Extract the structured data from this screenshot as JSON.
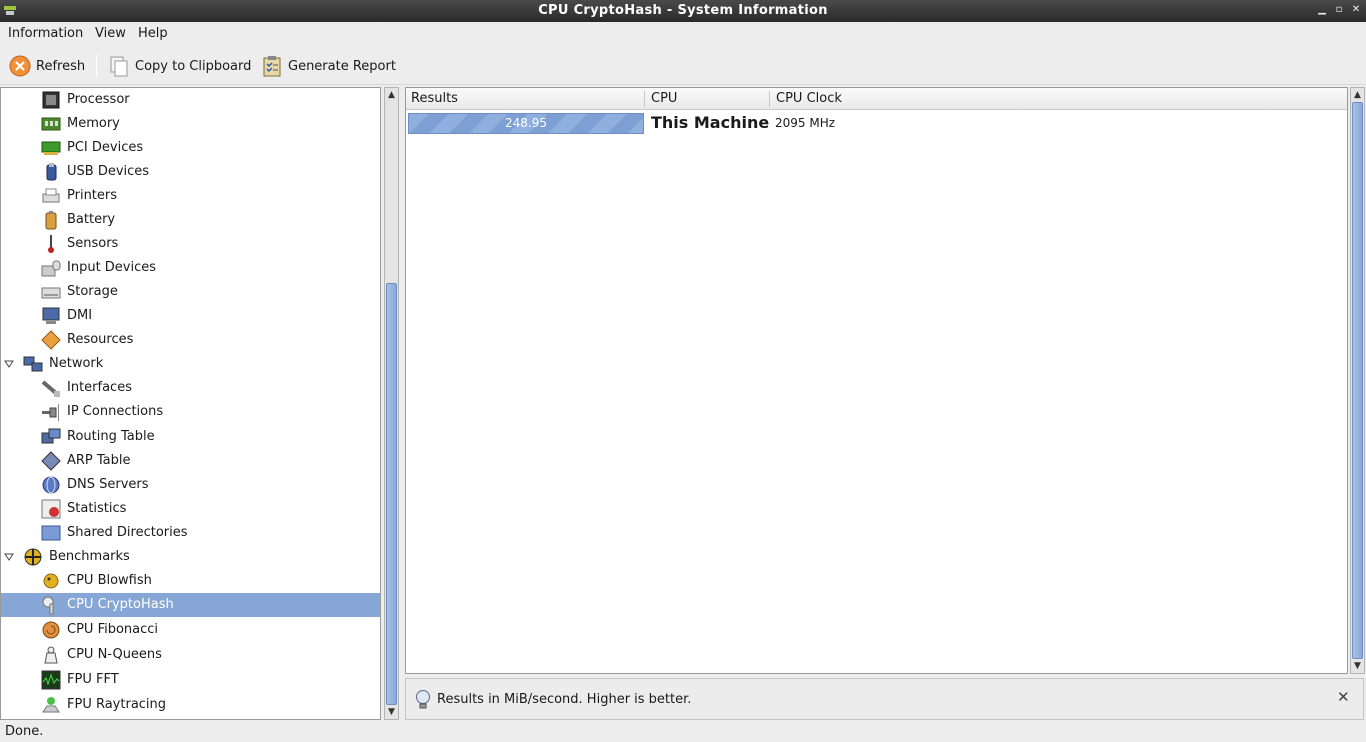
{
  "window": {
    "title": "CPU CryptoHash - System Information"
  },
  "menu": {
    "items": [
      "Information",
      "View",
      "Help"
    ]
  },
  "toolbar": {
    "refresh_label": "Refresh",
    "copy_label": "Copy to Clipboard",
    "report_label": "Generate Report"
  },
  "tree": {
    "items": [
      {
        "label": "Processor",
        "icon": "processor-icon"
      },
      {
        "label": "Memory",
        "icon": "memory-icon"
      },
      {
        "label": "PCI Devices",
        "icon": "pci-icon"
      },
      {
        "label": "USB Devices",
        "icon": "usb-icon"
      },
      {
        "label": "Printers",
        "icon": "printer-icon"
      },
      {
        "label": "Battery",
        "icon": "battery-icon"
      },
      {
        "label": "Sensors",
        "icon": "thermometer-icon"
      },
      {
        "label": "Input Devices",
        "icon": "input-devices-icon"
      },
      {
        "label": "Storage",
        "icon": "drive-icon"
      },
      {
        "label": "DMI",
        "icon": "monitor-icon"
      },
      {
        "label": "Resources",
        "icon": "resources-icon"
      },
      {
        "label": "Network",
        "icon": "network-icon"
      },
      {
        "label": "Interfaces",
        "icon": "cable-icon"
      },
      {
        "label": "IP Connections",
        "icon": "plug-icon"
      },
      {
        "label": "Routing Table",
        "icon": "computers-icon"
      },
      {
        "label": "ARP Table",
        "icon": "arp-icon"
      },
      {
        "label": "DNS Servers",
        "icon": "globe-icon"
      },
      {
        "label": "Statistics",
        "icon": "statistics-icon"
      },
      {
        "label": "Shared Directories",
        "icon": "folder-icon"
      },
      {
        "label": "Benchmarks",
        "icon": "benchmarks-icon"
      },
      {
        "label": "CPU Blowfish",
        "icon": "blowfish-icon"
      },
      {
        "label": "CPU CryptoHash",
        "icon": "cryptohash-icon"
      },
      {
        "label": "CPU Fibonacci",
        "icon": "shell-icon"
      },
      {
        "label": "CPU N-Queens",
        "icon": "queens-icon"
      },
      {
        "label": "FPU FFT",
        "icon": "fft-icon"
      },
      {
        "label": "FPU Raytracing",
        "icon": "raytracing-icon"
      }
    ]
  },
  "results": {
    "columns": [
      "Results",
      "CPU",
      "CPU Clock"
    ],
    "rows": [
      {
        "result": "248.95",
        "cpu": "This Machine",
        "clock": "2095 MHz"
      }
    ]
  },
  "info": {
    "text": "Results in MiB/second. Higher is better."
  },
  "status": {
    "text": "Done."
  },
  "colors": {
    "selection": "#86a7d6",
    "bar": "#8fb0df",
    "titlebar": "#2a2a2a"
  }
}
